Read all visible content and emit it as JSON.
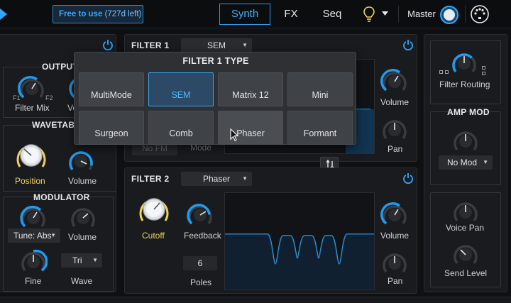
{
  "topbar": {
    "promo_text": "Free to use",
    "promo_days": "(727d left)",
    "tabs": [
      {
        "label": "Synth",
        "active": true
      },
      {
        "label": "FX",
        "active": false
      },
      {
        "label": "Seq",
        "active": false
      }
    ],
    "master_label": "Master"
  },
  "output": {
    "header": "OUTPUT",
    "f1": "F1",
    "f2": "F2",
    "filter_mix_label": "Filter Mix",
    "volume_label": "Vo"
  },
  "wavetable": {
    "header": "WAVETABL",
    "position_label": "Position",
    "volume_label": "Volume"
  },
  "modulator": {
    "header": "MODULATOR",
    "tune_value": "Tune: Abs",
    "volume_label": "Volume",
    "wave_value": "Tri",
    "fine_label": "Fine",
    "wave_label": "Wave"
  },
  "filter1": {
    "header": "FILTER 1",
    "type_value": "SEM",
    "volume_label": "Volume",
    "pan_label": "Pan",
    "hidden_field": "No FM",
    "mode_label": "Mode"
  },
  "popup": {
    "title": "FILTER 1 TYPE",
    "options": [
      "MultiMode",
      "SEM",
      "Matrix 12",
      "Mini",
      "Surgeon",
      "Comb",
      "Phaser",
      "Formant"
    ],
    "selected": "SEM"
  },
  "filter2": {
    "header": "FILTER 2",
    "type_value": "Phaser",
    "cutoff_label": "Cutoff",
    "feedback_label": "Feedback",
    "poles_value": "6",
    "poles_label": "Poles",
    "volume_label": "Volume",
    "pan_label": "Pan"
  },
  "right": {
    "filter_routing_label": "Filter Routing",
    "amp_mod_header": "AMP MOD",
    "amp_mod_value": "No Mod",
    "voice_pan_label": "Voice Pan",
    "send_level_label": "Send Level"
  },
  "colors": {
    "accent": "#2ea8ff",
    "knob_arc": "#1f9bf0",
    "yellow_label": "#f0d35a"
  }
}
